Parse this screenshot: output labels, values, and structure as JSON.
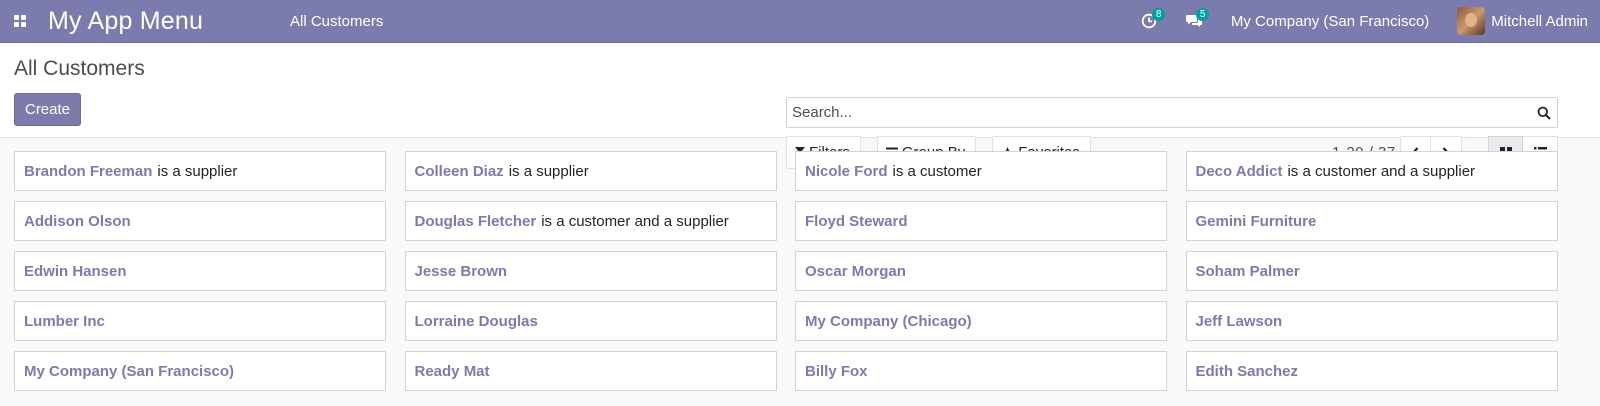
{
  "navbar": {
    "brand": "My App Menu",
    "menu_item": "All Customers",
    "activity_count": "8",
    "messages_count": "5",
    "company": "My Company (San Francisco)",
    "user_name": "Mitchell Admin"
  },
  "control_panel": {
    "title": "All Customers",
    "create_label": "Create",
    "search_placeholder": "Search...",
    "filters_label": "Filters",
    "group_by_label": "Group By",
    "favorites_label": "Favorites",
    "pager": "1-20 / 37"
  },
  "cards": [
    {
      "name": "Brandon Freeman",
      "desc": "is a supplier"
    },
    {
      "name": "Colleen Diaz",
      "desc": "is a supplier"
    },
    {
      "name": "Nicole Ford",
      "desc": "is a customer"
    },
    {
      "name": "Deco Addict",
      "desc": "is a customer and a supplier"
    },
    {
      "name": "Addison Olson",
      "desc": ""
    },
    {
      "name": "Douglas Fletcher",
      "desc": "is a customer and a supplier"
    },
    {
      "name": "Floyd Steward",
      "desc": ""
    },
    {
      "name": "Gemini Furniture",
      "desc": ""
    },
    {
      "name": "Edwin Hansen",
      "desc": ""
    },
    {
      "name": "Jesse Brown",
      "desc": ""
    },
    {
      "name": "Oscar Morgan",
      "desc": ""
    },
    {
      "name": "Soham Palmer",
      "desc": ""
    },
    {
      "name": "Lumber Inc",
      "desc": ""
    },
    {
      "name": "Lorraine Douglas",
      "desc": ""
    },
    {
      "name": "My Company (Chicago)",
      "desc": ""
    },
    {
      "name": "Jeff Lawson",
      "desc": ""
    },
    {
      "name": "My Company (San Francisco)",
      "desc": ""
    },
    {
      "name": "Ready Mat",
      "desc": ""
    },
    {
      "name": "Billy Fox",
      "desc": ""
    },
    {
      "name": "Edith Sanchez",
      "desc": ""
    }
  ],
  "colors": {
    "brand": "#7c7bad",
    "badge": "#00a09d"
  }
}
